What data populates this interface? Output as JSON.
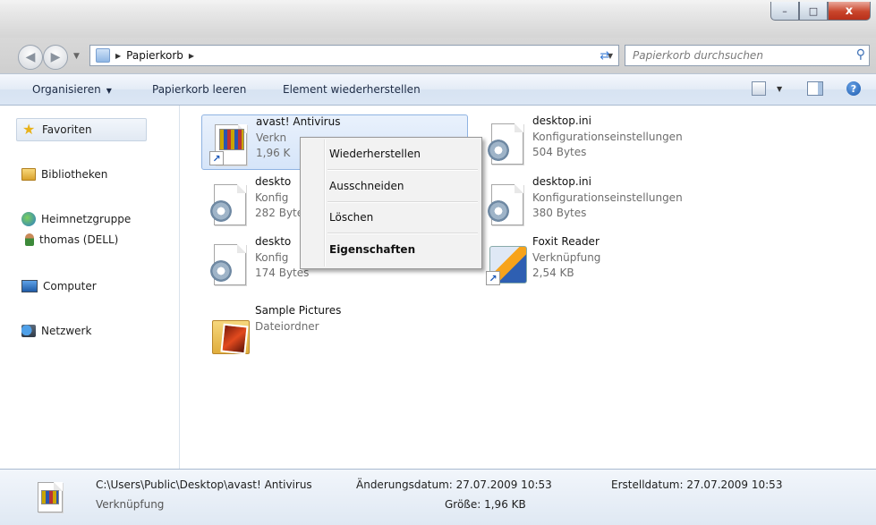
{
  "window": {
    "min_label": "–",
    "max_label": "□",
    "close_label": "x"
  },
  "address": {
    "breadcrumb": "Papierkorb",
    "search_placeholder": "Papierkorb durchsuchen"
  },
  "toolbar": {
    "organize": "Organisieren",
    "empty_bin": "Papierkorb leeren",
    "restore_item": "Element wiederherstellen",
    "help_label": "?"
  },
  "sidebar": {
    "favorites": "Favoriten",
    "libraries": "Bibliotheken",
    "homegroup": "Heimnetzgruppe",
    "user": "thomas (DELL)",
    "computer": "Computer",
    "network": "Netzwerk"
  },
  "files": [
    {
      "name": "avast! Antivirus",
      "type": "Verknüpfung",
      "size": "1,96 KB",
      "icon": "avast-shortcut-icon"
    },
    {
      "name": "desktop.ini",
      "type": "Konfigurationseinstellungen",
      "size": "504 Bytes",
      "icon": "config-file-icon"
    },
    {
      "name": "deskto",
      "type": "Konfig",
      "size": "282 Bytes",
      "icon": "config-file-icon"
    },
    {
      "name": "desktop.ini",
      "type": "Konfigurationseinstellungen",
      "size": "380 Bytes",
      "icon": "config-file-icon"
    },
    {
      "name": "deskto",
      "type": "Konfig",
      "size": "174 Bytes",
      "icon": "config-file-icon"
    },
    {
      "name": "Foxit Reader",
      "type": "Verknüpfung",
      "size": "2,54 KB",
      "icon": "foxit-shortcut-icon"
    },
    {
      "name": "Sample Pictures",
      "type": "Dateiordner",
      "size": "",
      "icon": "folder-icon"
    }
  ],
  "partial": {
    "file0_type": "Verkn",
    "file0_size": "1,96 K"
  },
  "context_menu": {
    "restore": "Wiederherstellen",
    "cut": "Ausschneiden",
    "delete": "Löschen",
    "properties": "Eigenschaften"
  },
  "status": {
    "path": "C:\\Users\\Public\\Desktop\\avast! Antivirus",
    "type": "Verknüpfung",
    "modified": "Änderungsdatum: 27.07.2009 10:53",
    "size": "Größe: 1,96 KB",
    "created": "Erstelldatum: 27.07.2009 10:53"
  },
  "colors": {
    "toolbar_bg": "#dbe6f4",
    "selection": "#d6e5f9",
    "close_button": "#c9452b"
  }
}
